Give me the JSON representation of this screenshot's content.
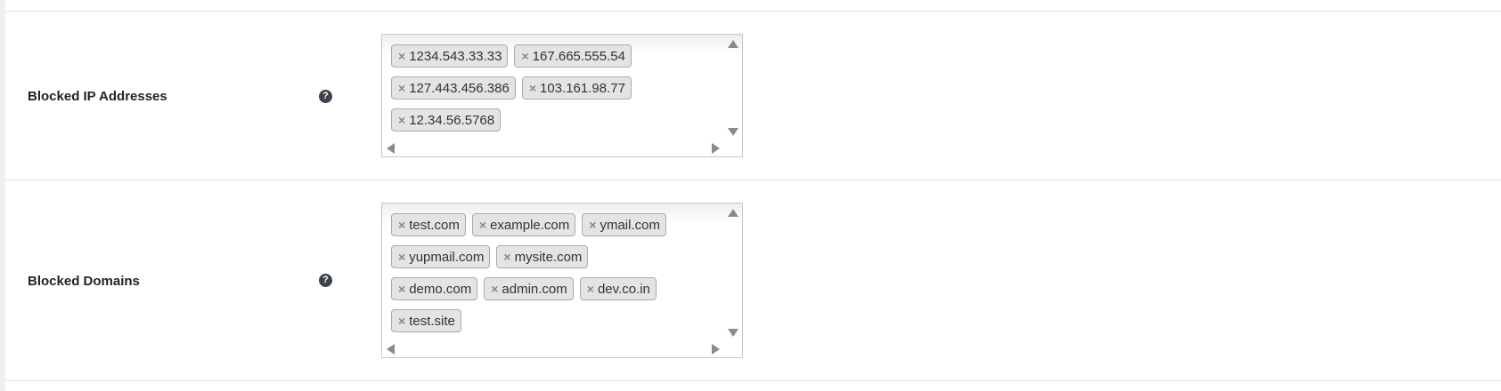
{
  "settings": {
    "rows": [
      {
        "label": "Blocked IP Addresses",
        "help_icon": "question-circle-icon",
        "tags": [
          "1234.543.33.33",
          "167.665.555.54",
          "127.443.456.386",
          "103.161.98.77",
          "12.34.56.5768"
        ]
      },
      {
        "label": "Blocked Domains",
        "help_icon": "question-circle-icon",
        "tags": [
          "test.com",
          "example.com",
          "ymail.com",
          "yupmail.com",
          "mysite.com",
          "demo.com",
          "admin.com",
          "dev.co.in",
          "test.site"
        ]
      }
    ],
    "remove_glyph": "×",
    "help_glyph": "?"
  }
}
